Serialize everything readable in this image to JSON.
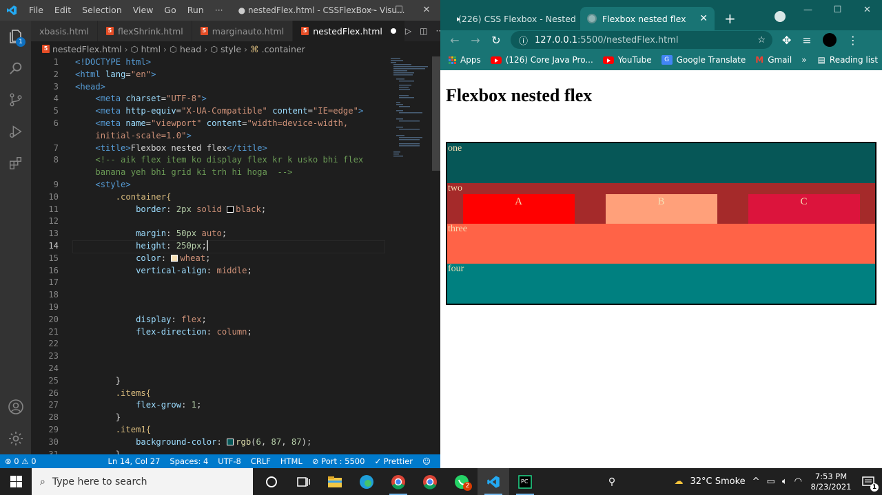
{
  "vscode": {
    "menu": [
      "File",
      "Edit",
      "Selection",
      "View",
      "Go",
      "Run",
      "···"
    ],
    "window_title": "● nestedFlex.html - CSSFlexBox - Visu...",
    "explorer_badge": "1",
    "tabs": [
      {
        "label": "xbasis.html"
      },
      {
        "label": "flexShrink.html"
      },
      {
        "label": "marginauto.html"
      },
      {
        "label": "nestedFlex.html"
      }
    ],
    "breadcrumb": [
      "nestedFlex.html",
      "html",
      "head",
      "style",
      ".container"
    ],
    "current_line": 14,
    "lines": [
      {
        "n": "1"
      },
      {
        "n": "2"
      },
      {
        "n": "3"
      },
      {
        "n": "4"
      },
      {
        "n": "5"
      },
      {
        "n": "6"
      },
      {
        "n": ""
      },
      {
        "n": "7"
      },
      {
        "n": "8"
      },
      {
        "n": ""
      },
      {
        "n": "9"
      },
      {
        "n": "10"
      },
      {
        "n": "11"
      },
      {
        "n": "12"
      },
      {
        "n": "13"
      },
      {
        "n": "14"
      },
      {
        "n": "15"
      },
      {
        "n": "16"
      },
      {
        "n": "17"
      },
      {
        "n": "18"
      },
      {
        "n": "19"
      },
      {
        "n": "20"
      },
      {
        "n": "21"
      },
      {
        "n": "22"
      },
      {
        "n": "23"
      },
      {
        "n": "24"
      },
      {
        "n": "25"
      },
      {
        "n": "26"
      },
      {
        "n": "27"
      },
      {
        "n": "28"
      },
      {
        "n": "29"
      },
      {
        "n": "30"
      },
      {
        "n": "31"
      }
    ],
    "code": {
      "l1": "<!DOCTYPE html>",
      "l2a": "<html ",
      "l2b": "lang",
      "l2c": "=",
      "l2d": "\"en\"",
      "l2e": ">",
      "l3": "<head>",
      "l4a": "<meta ",
      "l4b": "charset",
      "l4c": "=",
      "l4d": "\"UTF-8\"",
      "l4e": ">",
      "l5a": "<meta ",
      "l5b": "http-equiv",
      "l5c": "=",
      "l5d": "\"X-UA-Compatible\"",
      "l5e": " content",
      "l5f": "=",
      "l5g": "\"IE=edge\"",
      "l5h": ">",
      "l6a": "<meta ",
      "l6b": "name",
      "l6c": "=",
      "l6d": "\"viewport\"",
      "l6e": " content",
      "l6f": "=",
      "l6g": "\"width=device-width,",
      "l6w": "initial-scale=1.0\"",
      "l6x": ">",
      "l7a": "<title>",
      "l7b": "Flexbox nested flex",
      "l7c": "</title>",
      "l8a": "<!-- aik flex item ko display flex kr k usko bhi flex",
      "l8b": "banana yeh bhi grid ki trh hi hoga  -->",
      "l9": "<style>",
      "l10": ".container{",
      "l11a": "border",
      "l11b": ": ",
      "l11c": "2px",
      "l11d": " solid ",
      "l11e": "black",
      "l11f": ";",
      "l13a": "margin",
      "l13b": ": ",
      "l13c": "50px",
      "l13d": " auto",
      "l13e": ";",
      "l14a": "height",
      "l14b": ": ",
      "l14c": "250px",
      "l14d": ";",
      "l15a": "color",
      "l15b": ": ",
      "l15c": "wheat",
      "l15d": ";",
      "l16a": "vertical-align",
      "l16b": ": ",
      "l16c": "middle",
      "l16d": ";",
      "l20a": "display",
      "l20b": ": ",
      "l20c": "flex",
      "l20d": ";",
      "l21a": "flex-direction",
      "l21b": ": ",
      "l21c": "column",
      "l21d": ";",
      "l25": "}",
      "l26": ".items{",
      "l27a": "flex-grow",
      "l27b": ": ",
      "l27c": "1",
      "l27d": ";",
      "l28": "}",
      "l29": ".item1{",
      "l30a": "background-color",
      "l30b": ": ",
      "l30c": "rgb",
      "l30d": "(",
      "l30e": "6",
      "l30f": ", ",
      "l30g": "87",
      "l30h": ", ",
      "l30i": "87",
      "l30j": ");",
      "l31": "}"
    },
    "status": {
      "errors": "⊗ 0 ⚠ 0",
      "position": "Ln 14, Col 27",
      "spaces": "Spaces: 4",
      "encoding": "UTF-8",
      "eol": "CRLF",
      "language": "HTML",
      "port": "⊘ Port : 5500",
      "prettier": "✓ Prettier"
    }
  },
  "chrome": {
    "tabs": [
      {
        "label": "(226) CSS Flexbox - Nested"
      },
      {
        "label": "Flexbox nested flex"
      }
    ],
    "url_host": "127.0.0.1",
    "url_path": ":5500/nestedFlex.html",
    "bookmarks": [
      "Apps",
      "(126) Core Java Pro...",
      "YouTube",
      "Google Translate",
      "Gmail"
    ],
    "reading_list": "Reading list",
    "page": {
      "heading": "Flexbox nested flex",
      "items": [
        "one",
        "two",
        "three",
        "four"
      ],
      "inner": [
        "A",
        "B",
        "C"
      ]
    }
  },
  "taskbar": {
    "search_placeholder": "Type here to search",
    "weather": "32°C  Smoke",
    "time": "7:53 PM",
    "date": "8/23/2021",
    "notification_count": "1",
    "whatsapp_badge": "2"
  }
}
